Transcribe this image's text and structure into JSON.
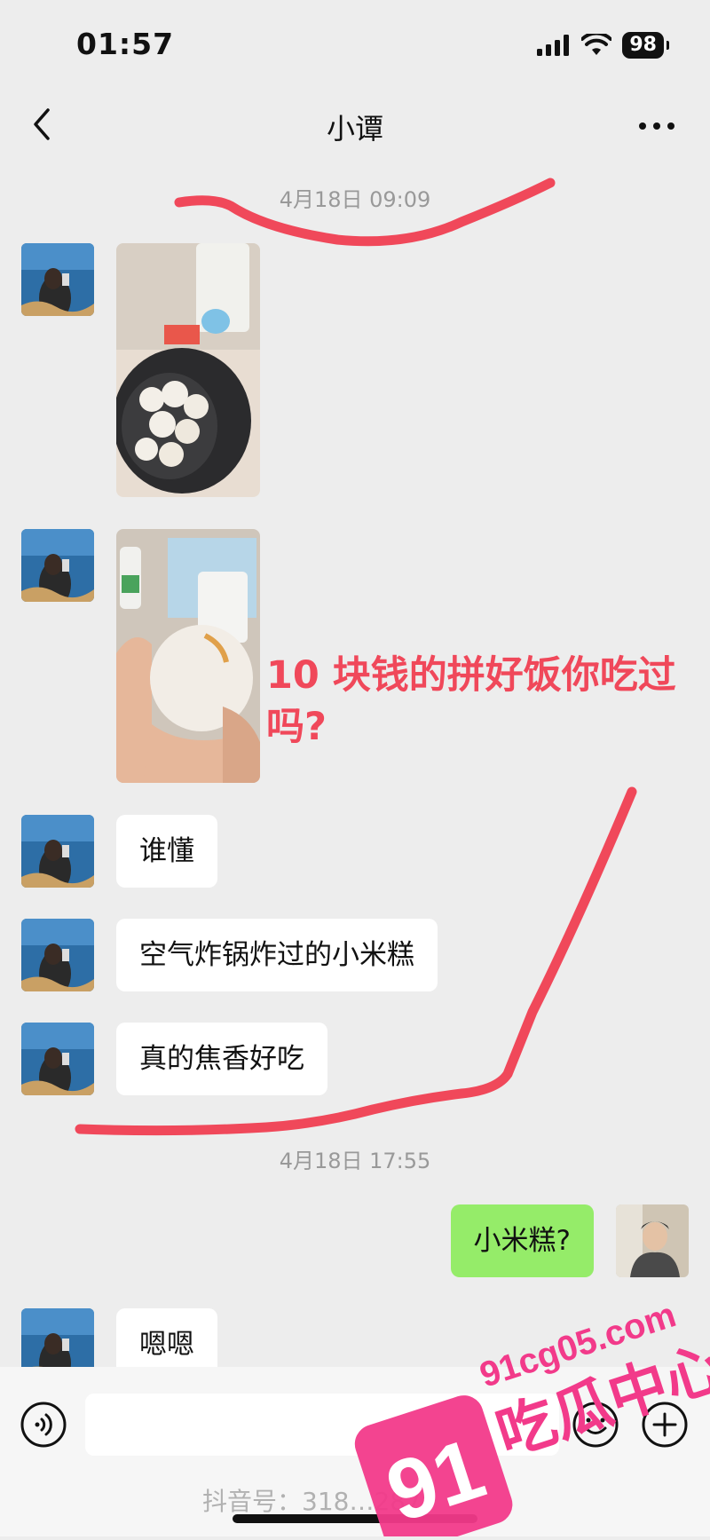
{
  "status_bar": {
    "time": "01:57",
    "battery": "98",
    "icons": [
      "signal-icon",
      "wifi-icon",
      "battery-icon"
    ]
  },
  "nav": {
    "title": "小谭",
    "back_icon": "chevron-left-icon",
    "more_icon": "more-icon"
  },
  "timestamps": [
    "4月18日 09:09",
    "4月18日 17:55"
  ],
  "messages": [
    {
      "side": "left",
      "type": "image",
      "description_icon": "photo-icon"
    },
    {
      "side": "left",
      "type": "image",
      "description_icon": "photo-icon"
    },
    {
      "side": "left",
      "type": "text",
      "text": "谁懂"
    },
    {
      "side": "left",
      "type": "text",
      "text": "空气炸锅炸过的小米糕"
    },
    {
      "side": "left",
      "type": "text",
      "text": "真的焦香好吃"
    },
    {
      "side": "right",
      "type": "text",
      "text": "小米糕?"
    },
    {
      "side": "left",
      "type": "text",
      "text": "嗯嗯"
    }
  ],
  "annotation": {
    "text": "10 块钱的拼好饭你吃过吗?",
    "color": "#f0485a"
  },
  "input_bar": {
    "placeholder": "",
    "icons": [
      "voice-icon",
      "emoji-icon",
      "plus-icon"
    ]
  },
  "watermarks": {
    "douyin": "抖音号：318…287",
    "site": "91cg05.com",
    "logo_number": "91",
    "logo_text": "吃瓜中心"
  },
  "colors": {
    "background": "#ededed",
    "bubble_self": "#95ec69",
    "bubble_other": "#ffffff",
    "highlight": "#f0485a",
    "logo": "#f23a8a"
  }
}
